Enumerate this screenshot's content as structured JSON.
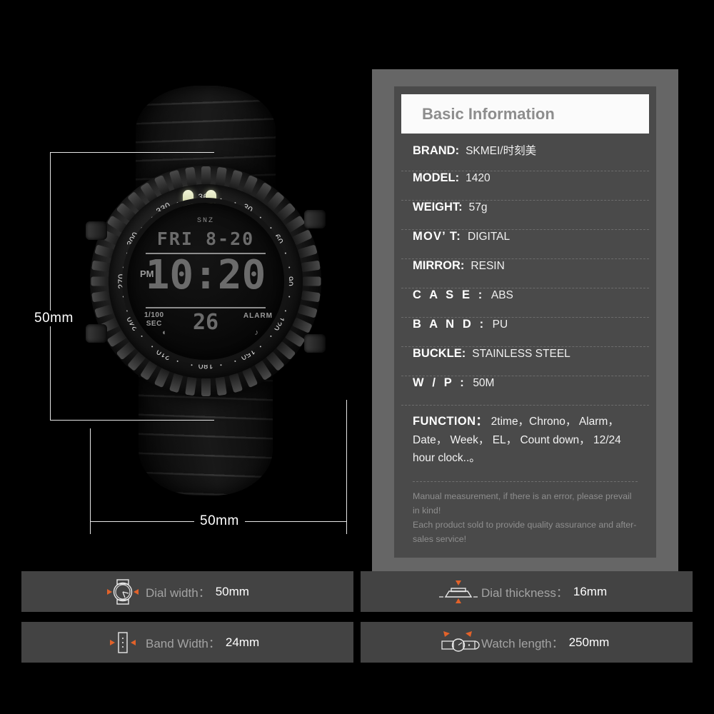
{
  "panel": {
    "header_title": "Basic Information",
    "specs": [
      {
        "label": "BRAND:",
        "value": "SKMEI/时刻美",
        "style": "normal"
      },
      {
        "label": "MODEL:",
        "value": "1420",
        "style": "normal"
      },
      {
        "label": "WEIGHT:",
        "value": "57g",
        "style": "normal"
      },
      {
        "label": "MOV’ T:",
        "value": "DIGITAL",
        "style": "semi"
      },
      {
        "label": "MIRROR:",
        "value": "RESIN",
        "style": "normal"
      },
      {
        "label": "C A S E :",
        "value": "ABS",
        "style": "wide"
      },
      {
        "label": "B A N D :",
        "value": "PU",
        "style": "wide"
      },
      {
        "label": "BUCKLE:",
        "value": "STAINLESS STEEL",
        "style": "normal"
      },
      {
        "label": "W / P :",
        "value": "50M",
        "style": "wide"
      }
    ],
    "function_label": "FUNCTION：",
    "function_value": "2time，Chrono， Alarm， Date， Week， EL， Count down， 12/24 hour clock..。",
    "footnote_line1": "Manual measurement, if there is an error, please prevail in kind!",
    "footnote_line2": "Each product sold to provide quality assurance and after-sales service!"
  },
  "dimensions": {
    "height_label": "50mm",
    "width_label": "50mm"
  },
  "bars": [
    {
      "icon": "watch-face-icon",
      "label": "Dial width：",
      "value": "50mm"
    },
    {
      "icon": "watch-profile-icon",
      "label": "Dial thickness：",
      "value": "16mm"
    },
    {
      "icon": "watch-band-icon",
      "label": "Band Width：",
      "value": "24mm"
    },
    {
      "icon": "watch-length-icon",
      "label": "Watch length：",
      "value": "250mm"
    }
  ],
  "watch": {
    "lcd": {
      "snooze": "SNZ",
      "date_row": "FRI 8-20",
      "ampm": "PM",
      "time": "10:20",
      "hundredths_line1": "1/100",
      "hundredths_line2": "SEC",
      "seconds": "26",
      "alarm": "ALARM"
    },
    "bezel_numbers": [
      "360",
      "30",
      "60",
      "90",
      "120",
      "150",
      "180",
      "210",
      "240",
      "270",
      "300",
      "330"
    ]
  },
  "colors": {
    "background": "#000000",
    "panel_outer": "#666666",
    "panel_inner": "#4a4a4a",
    "header_bg": "#fbfbfb",
    "header_text": "#8d8d8d",
    "bar_bg": "#434343",
    "accent_orange": "#e2622a"
  }
}
